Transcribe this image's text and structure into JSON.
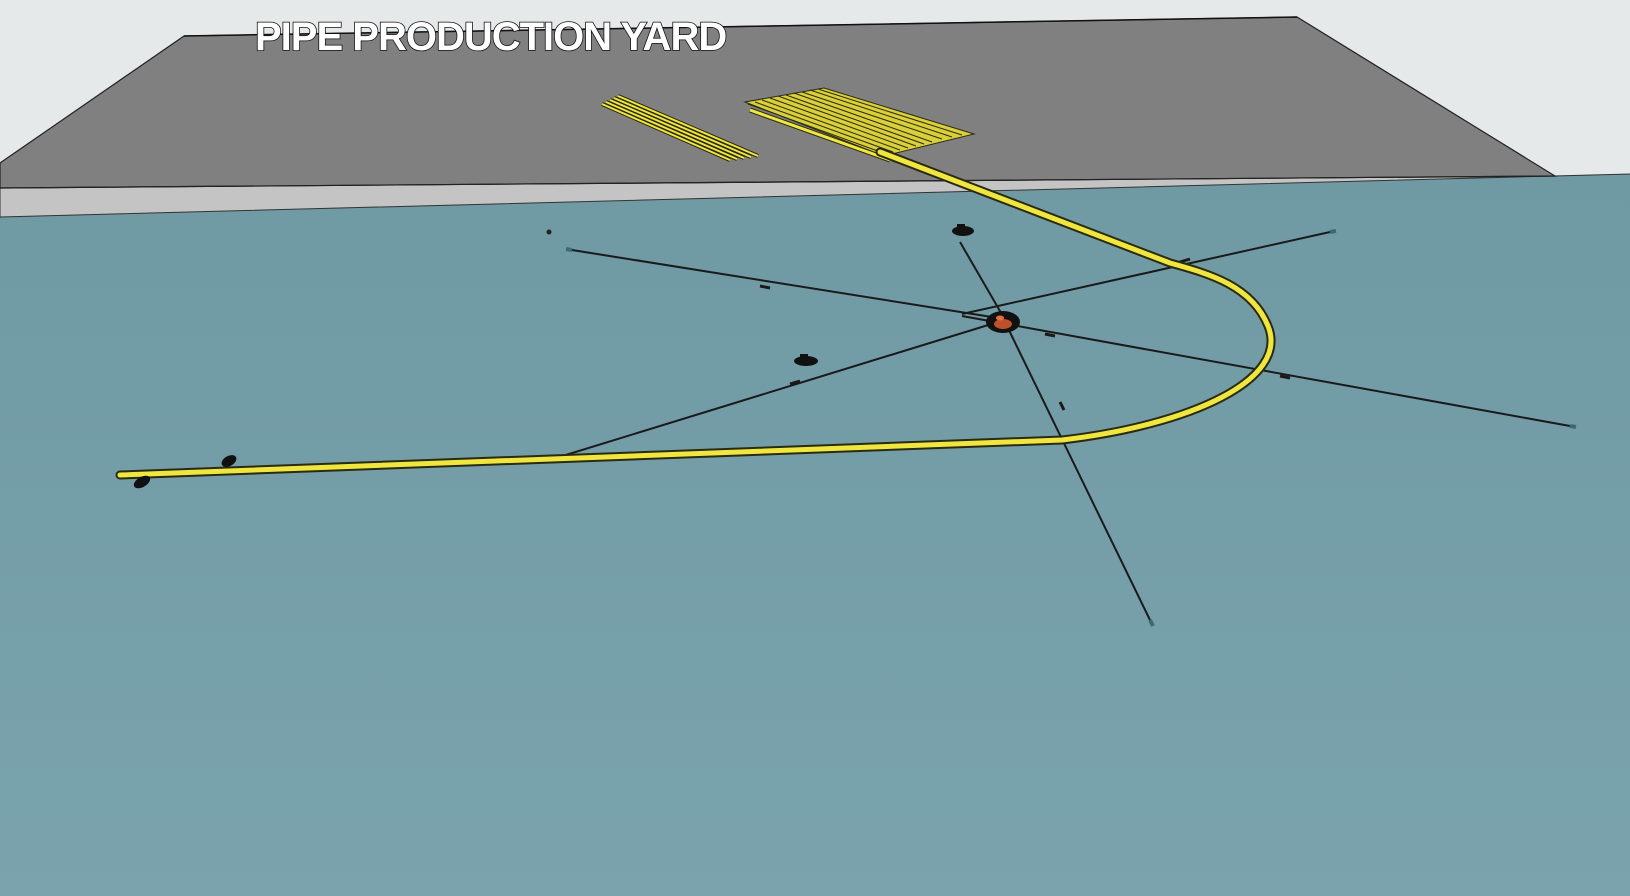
{
  "scene": {
    "title": "PIPE PRODUCTION YARD"
  },
  "colors": {
    "sky": "#e6e9ea",
    "water": "#729ca6",
    "yard_surface": "#808080",
    "quay_edge": "#c4c4c4",
    "pipe": "#f0e640",
    "pipe_outline": "#2a2a10",
    "mooring_line": "#1a1a1a",
    "vessel": "#111111",
    "barge_accent": "#c0502a"
  }
}
